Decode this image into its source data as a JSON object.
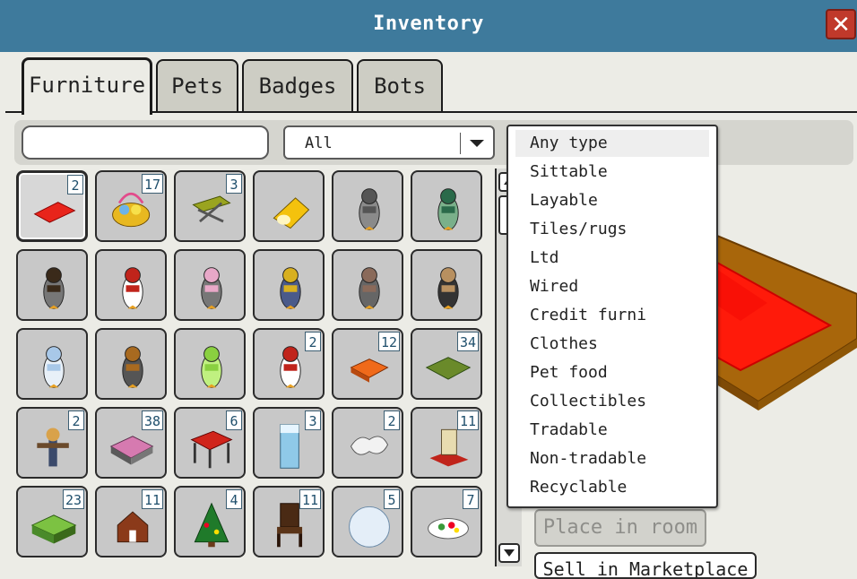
{
  "window": {
    "title": "Inventory",
    "close_label": "✕"
  },
  "tabs": [
    {
      "label": "Furniture",
      "active": true
    },
    {
      "label": "Pets"
    },
    {
      "label": "Badges"
    },
    {
      "label": "Bots"
    }
  ],
  "search": {
    "value": "",
    "placeholder": ""
  },
  "filter": {
    "selected": "All"
  },
  "type_dropdown": {
    "options": [
      "Any type",
      "Sittable",
      "Layable",
      "Tiles/rugs",
      "Ltd",
      "Wired",
      "Credit furni",
      "Clothes",
      "Pet food",
      "Collectibles",
      "Tradable",
      "Non-tradable",
      "Recyclable"
    ],
    "highlighted": "Any type"
  },
  "items": [
    {
      "name": "red-rug",
      "count": "2"
    },
    {
      "name": "egg-basket",
      "count": "17"
    },
    {
      "name": "folding-chair",
      "count": "3"
    },
    {
      "name": "yellow-lamp",
      "count": ""
    },
    {
      "name": "penguin-grey",
      "count": ""
    },
    {
      "name": "penguin-green",
      "count": ""
    },
    {
      "name": "penguin-afro",
      "count": ""
    },
    {
      "name": "penguin-striped",
      "count": ""
    },
    {
      "name": "penguin-tutu",
      "count": ""
    },
    {
      "name": "penguin-knight",
      "count": ""
    },
    {
      "name": "penguin-bandana",
      "count": ""
    },
    {
      "name": "penguin-cowboy",
      "count": ""
    },
    {
      "name": "penguin-skeleton",
      "count": ""
    },
    {
      "name": "penguin-hooded",
      "count": ""
    },
    {
      "name": "penguin-green-ghost",
      "count": ""
    },
    {
      "name": "penguin-santa",
      "count": "2"
    },
    {
      "name": "orange-cushion",
      "count": "12"
    },
    {
      "name": "grass-patch",
      "count": "34"
    },
    {
      "name": "scarecrow",
      "count": "2"
    },
    {
      "name": "pink-bed",
      "count": "38"
    },
    {
      "name": "red-table",
      "count": "6"
    },
    {
      "name": "ice-pillar",
      "count": "3"
    },
    {
      "name": "bearskin-rug",
      "count": "2"
    },
    {
      "name": "skeleton-throne",
      "count": "11"
    },
    {
      "name": "green-block",
      "count": "23"
    },
    {
      "name": "gingerbread-house",
      "count": "11"
    },
    {
      "name": "christmas-tree",
      "count": "4"
    },
    {
      "name": "wooden-chair",
      "count": "11"
    },
    {
      "name": "snowball",
      "count": "5"
    },
    {
      "name": "food-plate",
      "count": "7"
    }
  ],
  "actions": {
    "place_label": "Place in room",
    "sell_label": "Sell in Marketplace"
  },
  "colors": {
    "titlebar": "#3e7a9c",
    "close": "#c0392b",
    "count_text": "#1f4f6c"
  }
}
